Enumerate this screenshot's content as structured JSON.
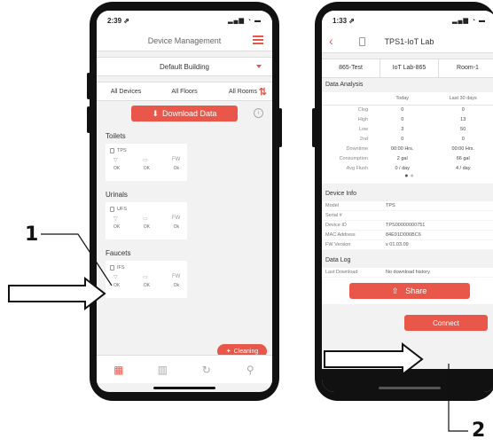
{
  "left": {
    "status_time": "2:39 ⇗",
    "status_icons": "▂▄▆ ◔ ▬",
    "title": "Device Management",
    "building": "Default Building",
    "filters": [
      "All Devices",
      "All Floors",
      "All Rooms"
    ],
    "download_label": "Download Data",
    "sections": [
      {
        "title": "Toilets",
        "device": "TPS",
        "labels": [
          "OK",
          "OK",
          "Ok"
        ],
        "fw": "FW"
      },
      {
        "title": "Urinals",
        "device": "UFS",
        "labels": [
          "OK",
          "OK",
          "Ok"
        ],
        "fw": "FW"
      },
      {
        "title": "Faucets",
        "device": "IFS",
        "labels": [
          "OK",
          "OK",
          "Ok"
        ],
        "fw": "FW"
      }
    ],
    "cleaning_label": "Cleaning"
  },
  "right": {
    "status_time": "1:33 ⇗",
    "status_icons": "▂▄▆ ◔ ▬",
    "title": "TPS1-IoT Lab",
    "location": [
      "865-Test",
      "IoT Lab-865",
      "Room-1"
    ],
    "data_analysis_title": "Data Analysis",
    "da_columns": [
      "",
      "Today",
      "Last 30 days"
    ],
    "da_rows": [
      [
        "Clog",
        "0",
        "0"
      ],
      [
        "High",
        "0",
        "13"
      ],
      [
        "Low",
        "3",
        "50"
      ],
      [
        "2nd",
        "0",
        "0"
      ],
      [
        "Downtime",
        "00:00 Hrs.",
        "00:00 Hrs."
      ],
      [
        "Consumption",
        "2 gal",
        "66 gal"
      ],
      [
        "Avg Flush",
        "0 / day",
        "4 / day"
      ]
    ],
    "device_info_title": "Device Info",
    "device_info": [
      [
        "Model",
        "TPS"
      ],
      [
        "Serial #",
        ""
      ],
      [
        "Device ID",
        "TPS00000000751"
      ],
      [
        "MAC Address",
        "84E91D006BC6"
      ],
      [
        "FW Version",
        "v 01.03.09"
      ]
    ],
    "data_log_title": "Data Log",
    "data_log": [
      [
        "Last Download",
        "No download history"
      ]
    ],
    "share_label": "Share",
    "connect_label": "Connect"
  },
  "annotations": {
    "one": "1",
    "two": "2"
  },
  "colors": {
    "accent": "#e8574a",
    "frame": "#111111",
    "background": "#f2f2f2"
  }
}
